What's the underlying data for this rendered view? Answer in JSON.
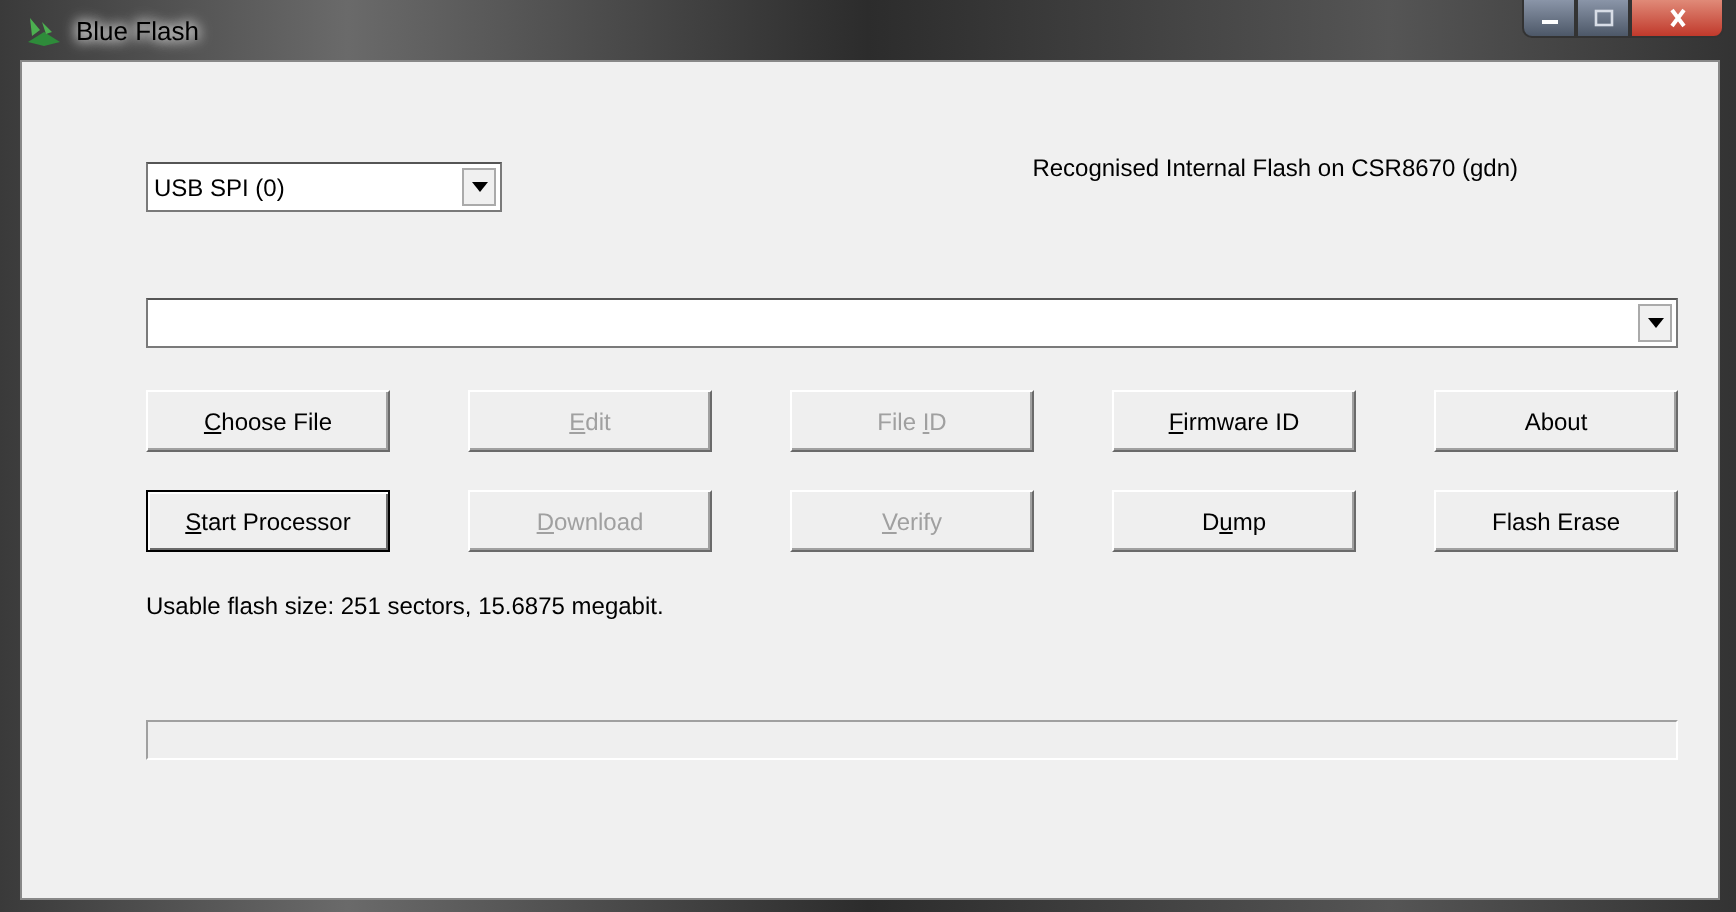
{
  "window": {
    "title": "Blue Flash"
  },
  "device_select": {
    "value": "USB SPI (0)"
  },
  "status_label": "Recognised Internal Flash on CSR8670 (gdn)",
  "buttons": [
    {
      "key": "C",
      "post": "hoose File",
      "disabled": false,
      "focused": false
    },
    {
      "key": "E",
      "post": "dit",
      "disabled": true,
      "focused": false
    },
    {
      "pre": "File ",
      "key": "I",
      "post": "D",
      "disabled": true,
      "focused": false
    },
    {
      "key": "F",
      "post": "irmware ID",
      "disabled": false,
      "focused": false
    },
    {
      "pre": "About",
      "disabled": false,
      "focused": false
    },
    {
      "key": "S",
      "post": "tart Processor",
      "disabled": false,
      "focused": true
    },
    {
      "key": "D",
      "post": "ownload",
      "disabled": true,
      "focused": false
    },
    {
      "key": "V",
      "post": "erify",
      "disabled": true,
      "focused": false
    },
    {
      "pre": "D",
      "key": "u",
      "post": "mp",
      "disabled": false,
      "focused": false
    },
    {
      "pre": "Flash Erase",
      "disabled": false,
      "focused": false
    }
  ],
  "info_text": "Usable flash size: 251 sectors, 15.6875 megabit."
}
